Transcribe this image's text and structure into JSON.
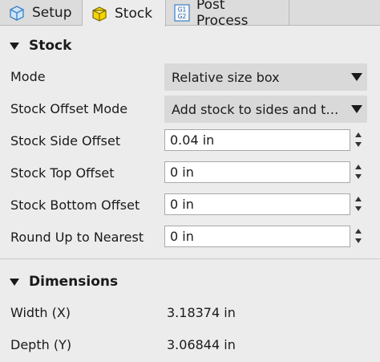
{
  "tabs": [
    {
      "label": "Setup",
      "icon": "setup-box-icon"
    },
    {
      "label": "Stock",
      "icon": "stock-cube-icon"
    },
    {
      "label": "Post Process",
      "icon": "g1-g2-icon",
      "icon_text": [
        "G1",
        "G2"
      ]
    }
  ],
  "active_tab": "Stock",
  "stock": {
    "heading": "Stock",
    "mode": {
      "label": "Mode",
      "value": "Relative size box"
    },
    "offset_mode": {
      "label": "Stock Offset Mode",
      "value": "Add stock to sides and to..."
    },
    "side_offset": {
      "label": "Stock Side Offset",
      "value": "0.04 in"
    },
    "top_offset": {
      "label": "Stock Top Offset",
      "value": "0 in"
    },
    "bottom_offset": {
      "label": "Stock Bottom Offset",
      "value": "0 in"
    },
    "round_up": {
      "label": "Round Up to Nearest",
      "value": "0 in"
    }
  },
  "dimensions": {
    "heading": "Dimensions",
    "width": {
      "label": "Width (X)",
      "value": "3.18374 in"
    },
    "depth": {
      "label": "Depth (Y)",
      "value": "3.06844 in"
    }
  },
  "colors": {
    "panel_bg": "#ececec",
    "tab_bg": "#dcdcdc",
    "dropdown_bg": "#d9d9d9",
    "cube_yellow": "#f5d400",
    "setup_icon_blue": "#5aa0d8"
  }
}
